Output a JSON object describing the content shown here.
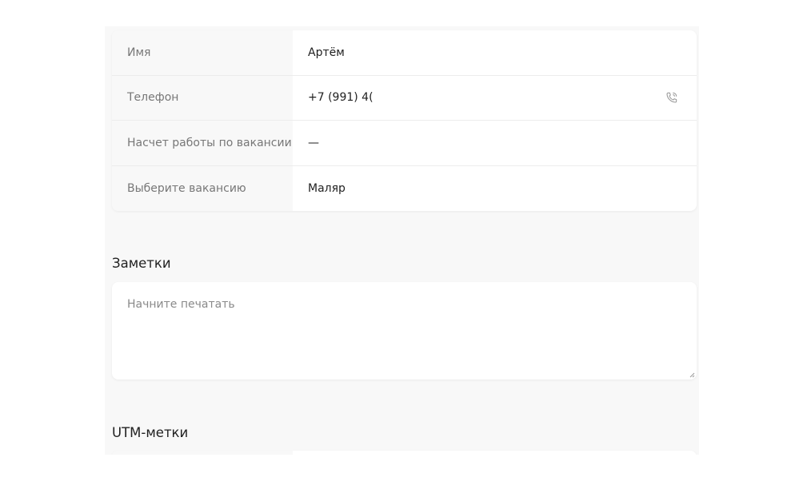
{
  "contact": {
    "rows": [
      {
        "label": "Имя",
        "value": "Артём"
      },
      {
        "label": "Телефон",
        "value": "+7 (991) 4("
      },
      {
        "label": "Насчет работы по вакансии",
        "value": "—"
      },
      {
        "label": "Выберите вакансию",
        "value": "Маляр"
      }
    ],
    "phone_icon": "phone-call-icon"
  },
  "notes": {
    "title": "Заметки",
    "placeholder": "Начните печатать",
    "value": ""
  },
  "utm": {
    "title": "UTM-метки"
  },
  "colors": {
    "panel_bg": "#f8f8f8",
    "card_bg": "#ffffff",
    "label_text": "#777777",
    "value_text": "#1f1f1f",
    "icon": "#9a9a9a"
  }
}
